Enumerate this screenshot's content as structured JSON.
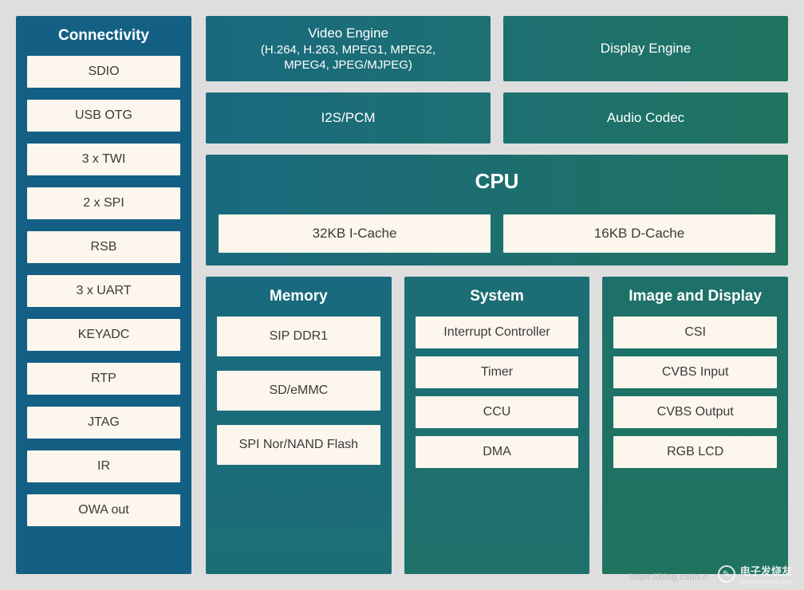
{
  "connectivity": {
    "title": "Connectivity",
    "items": [
      "SDIO",
      "USB OTG",
      "3 x TWI",
      "2 x SPI",
      "RSB",
      "3 x UART",
      "KEYADC",
      "RTP",
      "JTAG",
      "IR",
      "OWA out"
    ]
  },
  "row1": {
    "video": {
      "line1": "Video Engine",
      "line2": "(H.264, H.263, MPEG1, MPEG2,",
      "line3": "MPEG4, JPEG/MJPEG)"
    },
    "display": "Display Engine"
  },
  "row2": {
    "i2s": "I2S/PCM",
    "audio": "Audio Codec"
  },
  "cpu": {
    "title": "CPU",
    "icache": "32KB I-Cache",
    "dcache": "16KB D-Cache"
  },
  "memory": {
    "title": "Memory",
    "items": [
      "SIP DDR1",
      "SD/eMMC",
      "SPI Nor/NAND Flash"
    ]
  },
  "system": {
    "title": "System",
    "items": [
      "Interrupt Controller",
      "Timer",
      "CCU",
      "DMA"
    ]
  },
  "image": {
    "title": "Image and Display",
    "items": [
      "CSI",
      "CVBS Input",
      "CVBS Output",
      "RGB LCD"
    ]
  },
  "watermark": {
    "text": "电子发烧友",
    "sub": "www.elecfans.com",
    "url": "https://blog.csdn.n"
  }
}
